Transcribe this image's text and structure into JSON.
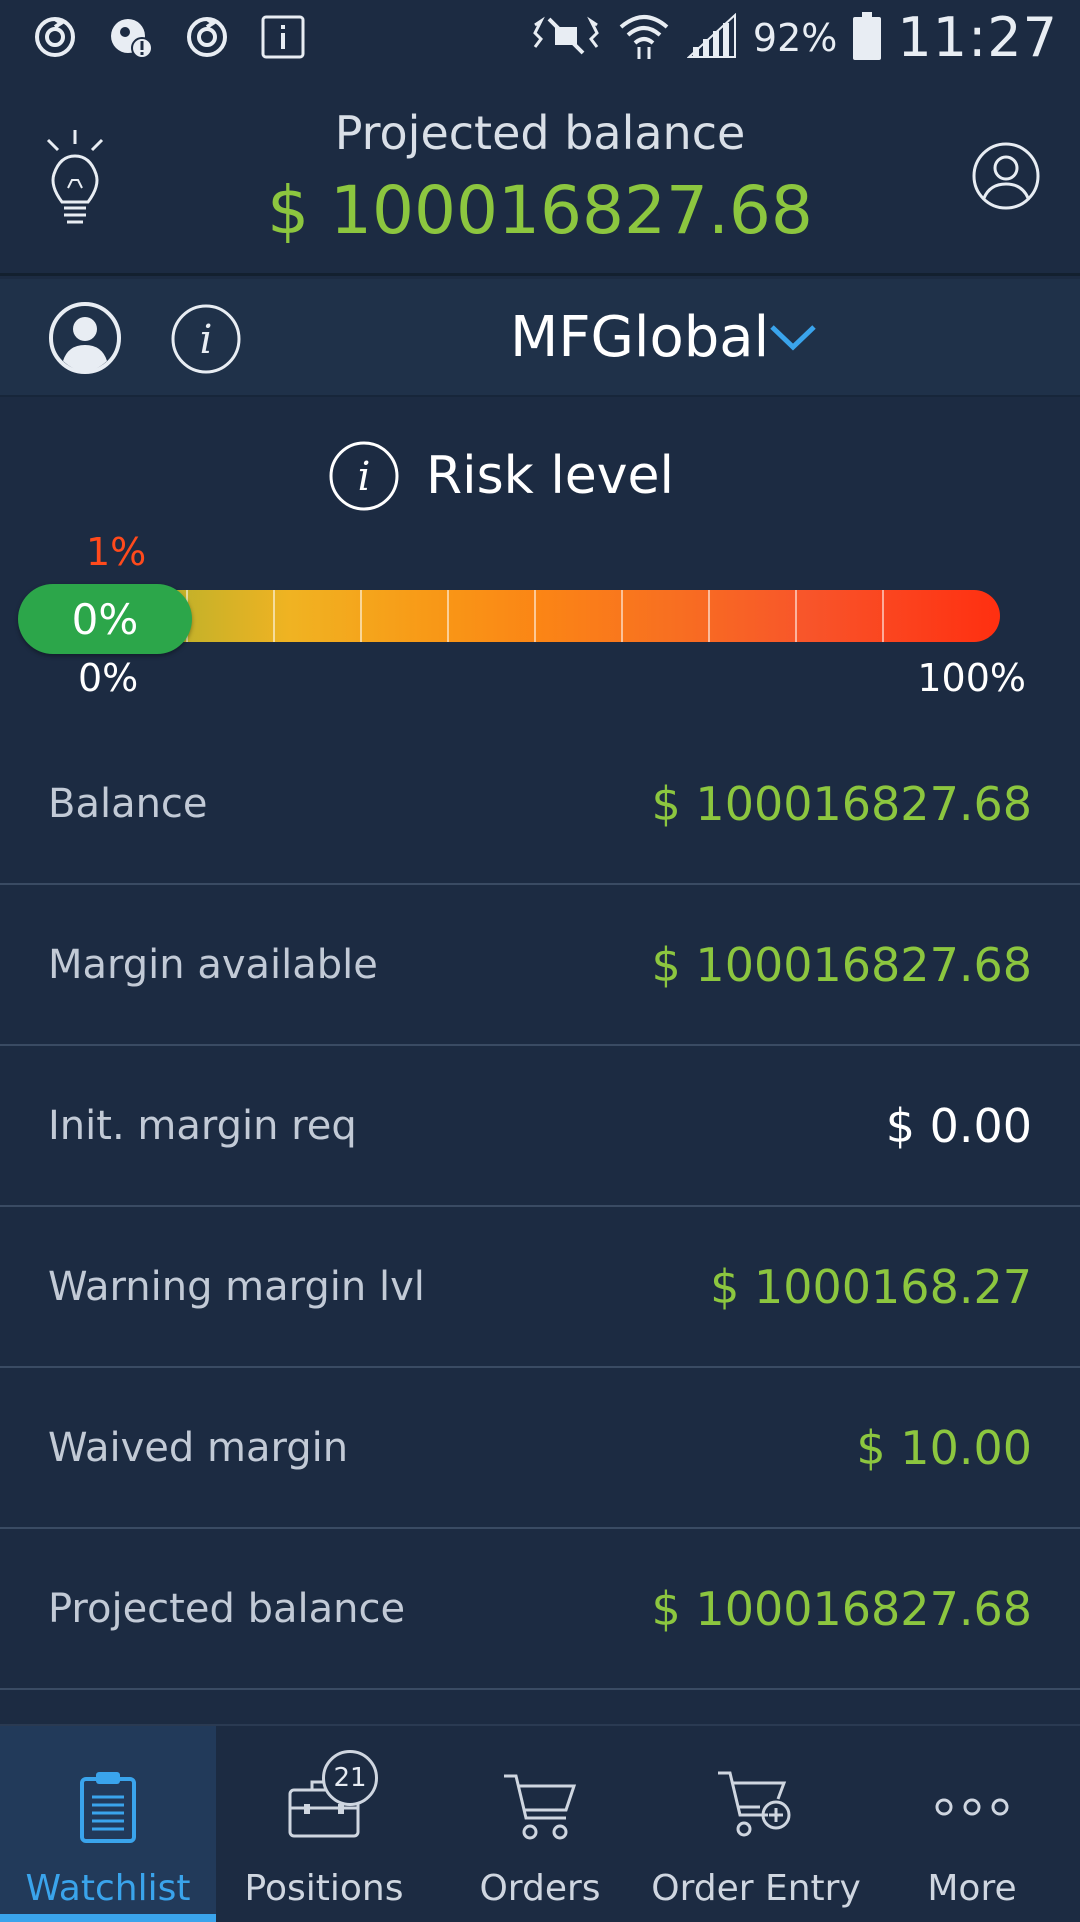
{
  "status_bar": {
    "battery": "92%",
    "time": "11:27",
    "left_icons": [
      "sync-icon",
      "alert-icon",
      "sync-icon",
      "info-icon"
    ],
    "right_icons": [
      "mute-icon",
      "wifi-icon",
      "signal-icon",
      "battery-icon"
    ]
  },
  "header": {
    "title": "Projected balance",
    "amount": "$ 100016827.68"
  },
  "account": {
    "name": "MFGlobal"
  },
  "risk": {
    "title": "Risk level",
    "knob_value": "0%",
    "marker_label": "1%",
    "min_label": "0%",
    "max_label": "100%",
    "level_percent": 0
  },
  "rows": [
    {
      "label": "Balance",
      "value": "$ 100016827.68",
      "color": "#8cc63f"
    },
    {
      "label": "Margin available",
      "value": "$ 100016827.68",
      "color": "#8cc63f"
    },
    {
      "label": "Init. margin req",
      "value": "$ 0.00",
      "color": "#ffffff"
    },
    {
      "label": "Warning margin lvl",
      "value": "$ 1000168.27",
      "color": "#8cc63f"
    },
    {
      "label": "Waived margin",
      "value": "$ 10.00",
      "color": "#8cc63f"
    },
    {
      "label": "Projected balance",
      "value": "$ 100016827.68",
      "color": "#8cc63f"
    }
  ],
  "nav": [
    {
      "label": "Watchlist",
      "icon": "clipboard-icon",
      "active": true
    },
    {
      "label": "Positions",
      "icon": "briefcase-icon",
      "badge": "21"
    },
    {
      "label": "Orders",
      "icon": "cart-icon"
    },
    {
      "label": "Order Entry",
      "icon": "cart-add-icon"
    },
    {
      "label": "More",
      "icon": "more-dots-icon"
    }
  ],
  "colors": {
    "accent_green": "#8cc63f",
    "accent_blue": "#3aa4ec",
    "background": "#1c2b42",
    "knob_green": "#2ca64a"
  }
}
